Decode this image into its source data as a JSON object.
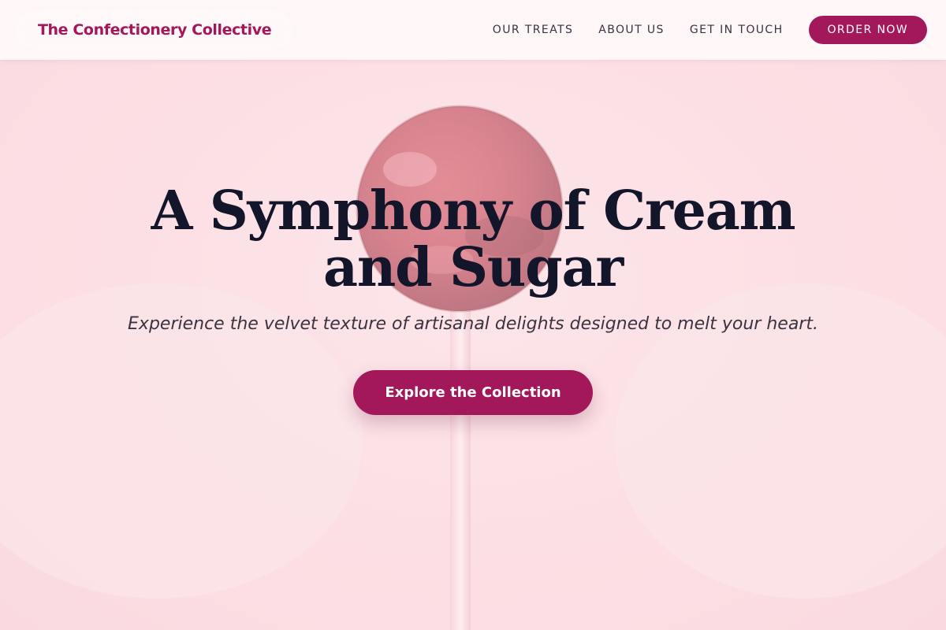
{
  "brand": {
    "name": "The Confectionery Collective"
  },
  "nav": {
    "links": [
      "OUR TREATS",
      "ABOUT US",
      "GET IN TOUCH"
    ],
    "order_label": "ORDER NOW"
  },
  "hero": {
    "headline": "A Symphony of Cream and Sugar",
    "subheadline": "Experience the velvet texture of artisanal delights designed to melt your heart.",
    "cta_label": "Explore the Collection",
    "image_subject": "red-lollipop"
  },
  "colors": {
    "accent": "#a3185a",
    "headline": "#13162a",
    "background": "#fde2e6"
  }
}
